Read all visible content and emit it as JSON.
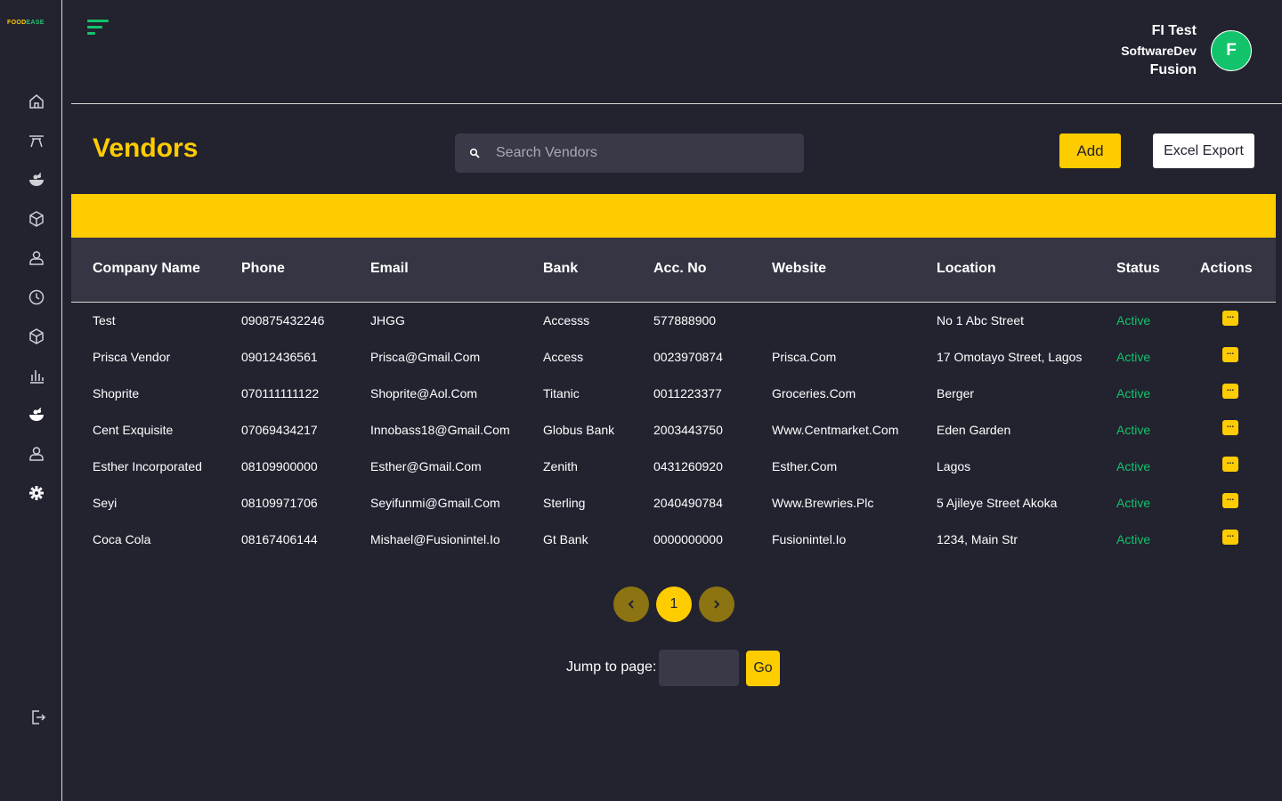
{
  "app": {
    "logo_part1": "FOOD",
    "logo_part2": "EASE"
  },
  "sidebar": {
    "items": [
      {
        "icon": "home-icon"
      },
      {
        "icon": "dining-table-icon"
      },
      {
        "icon": "food-bowl-icon"
      },
      {
        "icon": "package-icon"
      },
      {
        "icon": "user-icon"
      },
      {
        "icon": "clock-icon"
      },
      {
        "icon": "inventory-box-icon"
      },
      {
        "icon": "bar-chart-icon"
      },
      {
        "icon": "groceries-icon"
      },
      {
        "icon": "staff-user-icon"
      },
      {
        "icon": "settings-gear-icon"
      }
    ],
    "logout_icon": "logout-icon"
  },
  "header": {
    "user_name": "FI Test",
    "user_role": "SoftwareDev",
    "user_org": "Fusion",
    "avatar_initial": "F"
  },
  "page": {
    "title": "Vendors",
    "search_placeholder": "Search Vendors",
    "add_label": "Add",
    "export_label": "Excel Export"
  },
  "table": {
    "columns": [
      "Company Name",
      "Phone",
      "Email",
      "Bank",
      "Acc. No",
      "Website",
      "Location",
      "Status",
      "Actions"
    ],
    "rows": [
      {
        "company": "Test",
        "phone": "090875432246",
        "email": "JHGG",
        "bank": "Accesss",
        "acc": "577888900",
        "website": "",
        "location": "No 1 Abc Street",
        "status": "Active",
        "action": "..."
      },
      {
        "company": "Prisca Vendor",
        "phone": "09012436561",
        "email": "Prisca@Gmail.Com",
        "bank": "Access",
        "acc": "0023970874",
        "website": "Prisca.Com",
        "location": "17 Omotayo Street, Lagos",
        "status": "Active",
        "action": "..."
      },
      {
        "company": "Shoprite",
        "phone": "070111111122",
        "email": "Shoprite@Aol.Com",
        "bank": "Titanic",
        "acc": "0011223377",
        "website": "Groceries.Com",
        "location": "Berger",
        "status": "Active",
        "action": "..."
      },
      {
        "company": "Cent Exquisite",
        "phone": "07069434217",
        "email": "Innobass18@Gmail.Com",
        "bank": "Globus Bank",
        "acc": "2003443750",
        "website": "Www.Centmarket.Com",
        "location": "Eden Garden",
        "status": "Active",
        "action": "..."
      },
      {
        "company": "Esther Incorporated",
        "phone": "08109900000",
        "email": "Esther@Gmail.Com",
        "bank": "Zenith",
        "acc": "0431260920",
        "website": "Esther.Com",
        "location": "Lagos",
        "status": "Active",
        "action": "..."
      },
      {
        "company": "Seyi",
        "phone": "08109971706",
        "email": "Seyifunmi@Gmail.Com",
        "bank": "Sterling",
        "acc": "2040490784",
        "website": "Www.Brewries.Plc",
        "location": "5 Ajileye Street Akoka",
        "status": "Active",
        "action": "..."
      },
      {
        "company": "Coca Cola",
        "phone": "08167406144",
        "email": "Mishael@Fusionintel.Io",
        "bank": "Gt Bank",
        "acc": "0000000000",
        "website": "Fusionintel.Io",
        "location": "1234, Main Str",
        "status": "Active",
        "action": "..."
      }
    ]
  },
  "pagination": {
    "current_page": "1",
    "jump_label": "Jump to page:",
    "go_label": "Go"
  },
  "colors": {
    "background": "#22232f",
    "accent": "#ffcc00",
    "status_active": "#12c36b",
    "table_header": "#353643"
  }
}
